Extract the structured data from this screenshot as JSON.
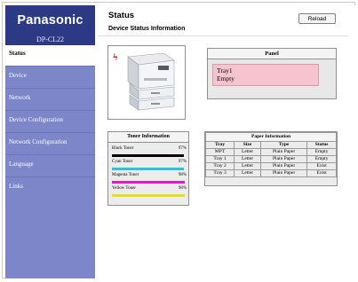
{
  "sidebar": {
    "brand": "Panasonic",
    "model": "DP-CL22",
    "items": [
      {
        "label": "Status",
        "active": true
      },
      {
        "label": "Device",
        "active": false
      },
      {
        "label": "Network",
        "active": false
      },
      {
        "label": "Device Configuration",
        "active": false
      },
      {
        "label": "Network Configuration",
        "active": false
      },
      {
        "label": "Language",
        "active": false
      },
      {
        "label": "Links",
        "active": false
      }
    ]
  },
  "header": {
    "title": "Status",
    "subtitle": "Device Status Information",
    "reload_label": "Reload"
  },
  "printer": {
    "alert_icon": "red-lightning-icon",
    "image_icon": "printer-icon"
  },
  "panel": {
    "title": "Panel",
    "line1": "Tray1",
    "line2": "Empty",
    "lcd_color": "#f6c4cf"
  },
  "toner": {
    "title": "Toner Information",
    "items": [
      {
        "label": "Black Toner",
        "percent": "97%",
        "level": 0.97,
        "color": "#000000"
      },
      {
        "label": "Cyan Toner",
        "percent": "97%",
        "level": 0.97,
        "color": "#1ec9e8"
      },
      {
        "label": "Magenta Toner",
        "percent": "98%",
        "level": 0.98,
        "color": "#e01cc7"
      },
      {
        "label": "Yellow Toner",
        "percent": "98%",
        "level": 0.98,
        "color": "#e6df1a"
      }
    ]
  },
  "paper": {
    "title": "Paper Information",
    "columns": [
      "Tray",
      "Size",
      "Type",
      "Status"
    ],
    "rows": [
      [
        "MPT",
        "Letter",
        "Plain Paper",
        "Empty"
      ],
      [
        "Tray 1",
        "Letter",
        "Plain Paper",
        "Empty"
      ],
      [
        "Tray 2",
        "Letter",
        "Plain Paper",
        "Exist"
      ],
      [
        "Tray 3",
        "Letter",
        "Plain Paper",
        "Exist"
      ]
    ]
  }
}
